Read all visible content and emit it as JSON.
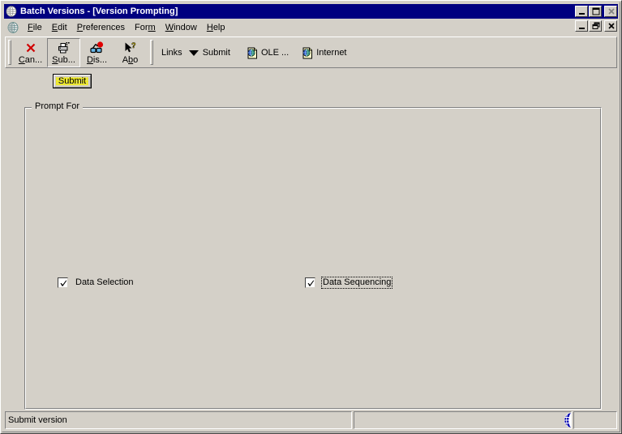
{
  "window": {
    "title": "Batch Versions - [Version Prompting]",
    "app_icon": "globe-icon",
    "controls": {
      "minimize": "minimize-icon",
      "maximize": "maximize-icon",
      "close": "close-icon",
      "child_minimize": "minimize-icon",
      "child_restore": "restore-icon",
      "child_close": "close-icon"
    }
  },
  "menubar": {
    "icon": "globe-icon",
    "items": [
      {
        "label": "File",
        "accel_index": 0
      },
      {
        "label": "Edit",
        "accel_index": 0
      },
      {
        "label": "Preferences",
        "accel_index": 0
      },
      {
        "label": "Form",
        "accel_index": 3
      },
      {
        "label": "Window",
        "accel_index": 0
      },
      {
        "label": "Help",
        "accel_index": 0
      }
    ]
  },
  "toolbar": {
    "buttons": [
      {
        "label": "Can...",
        "accel_index": 0,
        "icon": "red-x-cancel-icon",
        "name": "cancel"
      },
      {
        "label": "Sub...",
        "accel_index": 0,
        "icon": "printer-submit-icon",
        "name": "submit"
      },
      {
        "label": "Dis...",
        "accel_index": 0,
        "icon": "glasses-display-icon",
        "name": "display"
      },
      {
        "label": "Abo",
        "accel_index": 1,
        "icon": "arrow-question-about-icon",
        "name": "about"
      }
    ],
    "links_label": "Links",
    "links_dropdown": {
      "label": "Submit",
      "icon": "chevron-down-icon"
    },
    "links": [
      {
        "label": "OLE ...",
        "icon": "page-globe-icon",
        "name": "ole"
      },
      {
        "label": "Internet",
        "icon": "page-globe-icon",
        "name": "internet"
      }
    ]
  },
  "form": {
    "submit_button": {
      "label": "Submit",
      "focused": true
    },
    "groupbox": {
      "title": "Prompt For"
    },
    "checkboxes": [
      {
        "label": "Data Selection",
        "checked": true,
        "focused": false,
        "name": "data-selection"
      },
      {
        "label": "Data Sequencing",
        "checked": true,
        "focused": true,
        "name": "data-sequencing"
      }
    ]
  },
  "statusbar": {
    "message": "Submit version",
    "middle": "",
    "right_icon": "globe-icon"
  },
  "colors": {
    "titlebar": "#000080",
    "titlebar_text": "#ffffff",
    "face": "#d4d0c8",
    "shadow": "#808080",
    "highlight": "#ffffff",
    "focus_yellow": "#f4f000",
    "cancel_red": "#ff0000",
    "globe_blue": "#0000a0"
  }
}
